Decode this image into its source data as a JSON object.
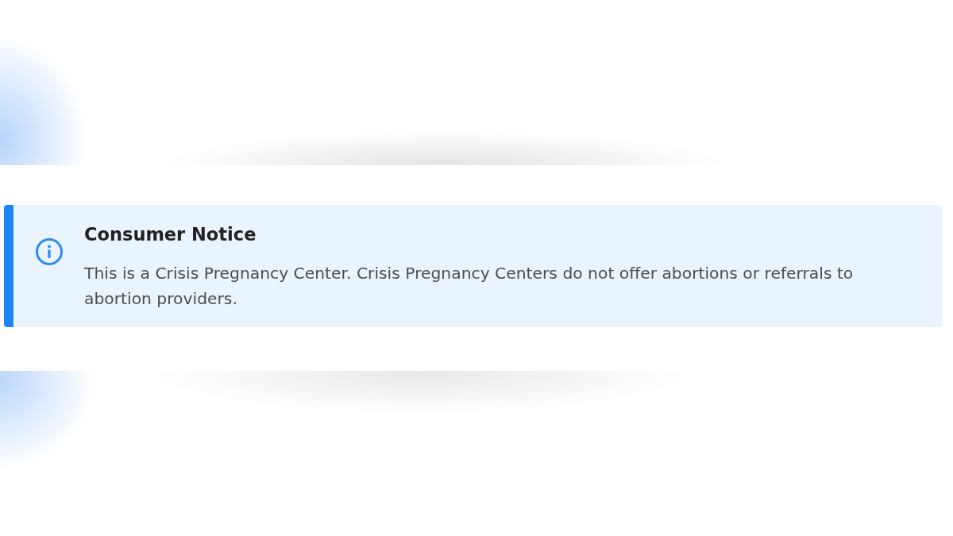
{
  "notice": {
    "title": "Consumer Notice",
    "message": "This is a Crisis Pregnancy Center. Crisis Pregnancy Centers do not offer abortions or referrals to abortion providers."
  }
}
